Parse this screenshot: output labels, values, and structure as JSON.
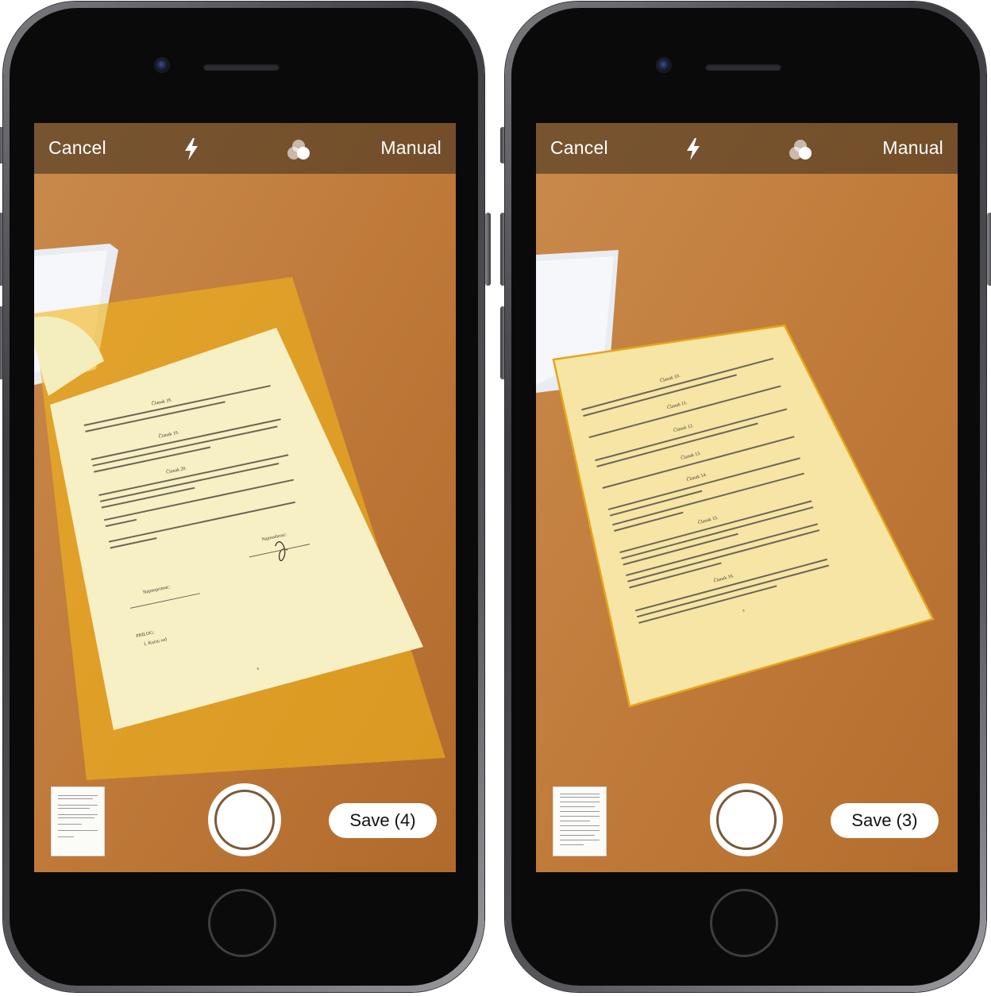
{
  "screens": [
    {
      "id": "left",
      "top_bar": {
        "cancel_label": "Cancel",
        "manual_label": "Manual",
        "icons": [
          "flash-icon",
          "filters-icon"
        ]
      },
      "bottom_bar": {
        "save_label": "Save (4)",
        "shutter": "shutter-button",
        "thumbnail": "scan-thumbnail"
      },
      "document": {
        "headings": [
          "Članak 18.",
          "Članak 19.",
          "Članak 20."
        ],
        "signature_left": "Najmoprimac:",
        "signature_right": "Najmodavac:",
        "annex": "PRILOG:",
        "annex_item": "1.   Kućni red",
        "page_number": "4"
      }
    },
    {
      "id": "right",
      "top_bar": {
        "cancel_label": "Cancel",
        "manual_label": "Manual",
        "icons": [
          "flash-icon",
          "filters-icon"
        ]
      },
      "bottom_bar": {
        "save_label": "Save (3)",
        "shutter": "shutter-button",
        "thumbnail": "scan-thumbnail"
      },
      "document": {
        "headings": [
          "Članak 10.",
          "Članak 11.",
          "Članak 12.",
          "Članak 13.",
          "Članak 14.",
          "Članak 15.",
          "Članak 16."
        ],
        "page_number": "3"
      }
    }
  ],
  "colors": {
    "carpet": "#c07b3a",
    "detection_overlay": "#f2b51c",
    "paper": "#f7f0c4",
    "top_bar": "rgba(70,52,32,0.62)",
    "button_bg": "#ffffff"
  }
}
